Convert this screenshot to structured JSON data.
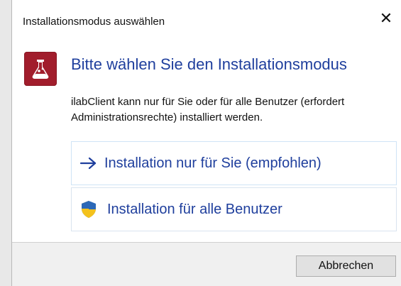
{
  "window": {
    "title": "Installationsmodus auswählen",
    "close_glyph": "✕"
  },
  "content": {
    "headline": "Bitte wählen Sie den Installationsmodus",
    "description": "ilabClient kann nur für Sie oder für alle Benutzer (erfordert Administrationsrechte) installiert werden."
  },
  "options": [
    {
      "label": "Installation nur für Sie (empfohlen)",
      "icon": "arrow-right-icon"
    },
    {
      "label": "Installation für alle Benutzer",
      "icon": "shield-icon"
    }
  ],
  "footer": {
    "cancel_label": "Abbrechen"
  },
  "colors": {
    "accent": "#1f3f9d",
    "app_icon": "#a11d2c",
    "shield_blue": "#2c68b7",
    "shield_yellow": "#f4c21c",
    "footer_bg": "#f0f0f0"
  },
  "icons": {
    "app": "lab-flask-icon",
    "cursor": "mouse-pointer-icon"
  }
}
